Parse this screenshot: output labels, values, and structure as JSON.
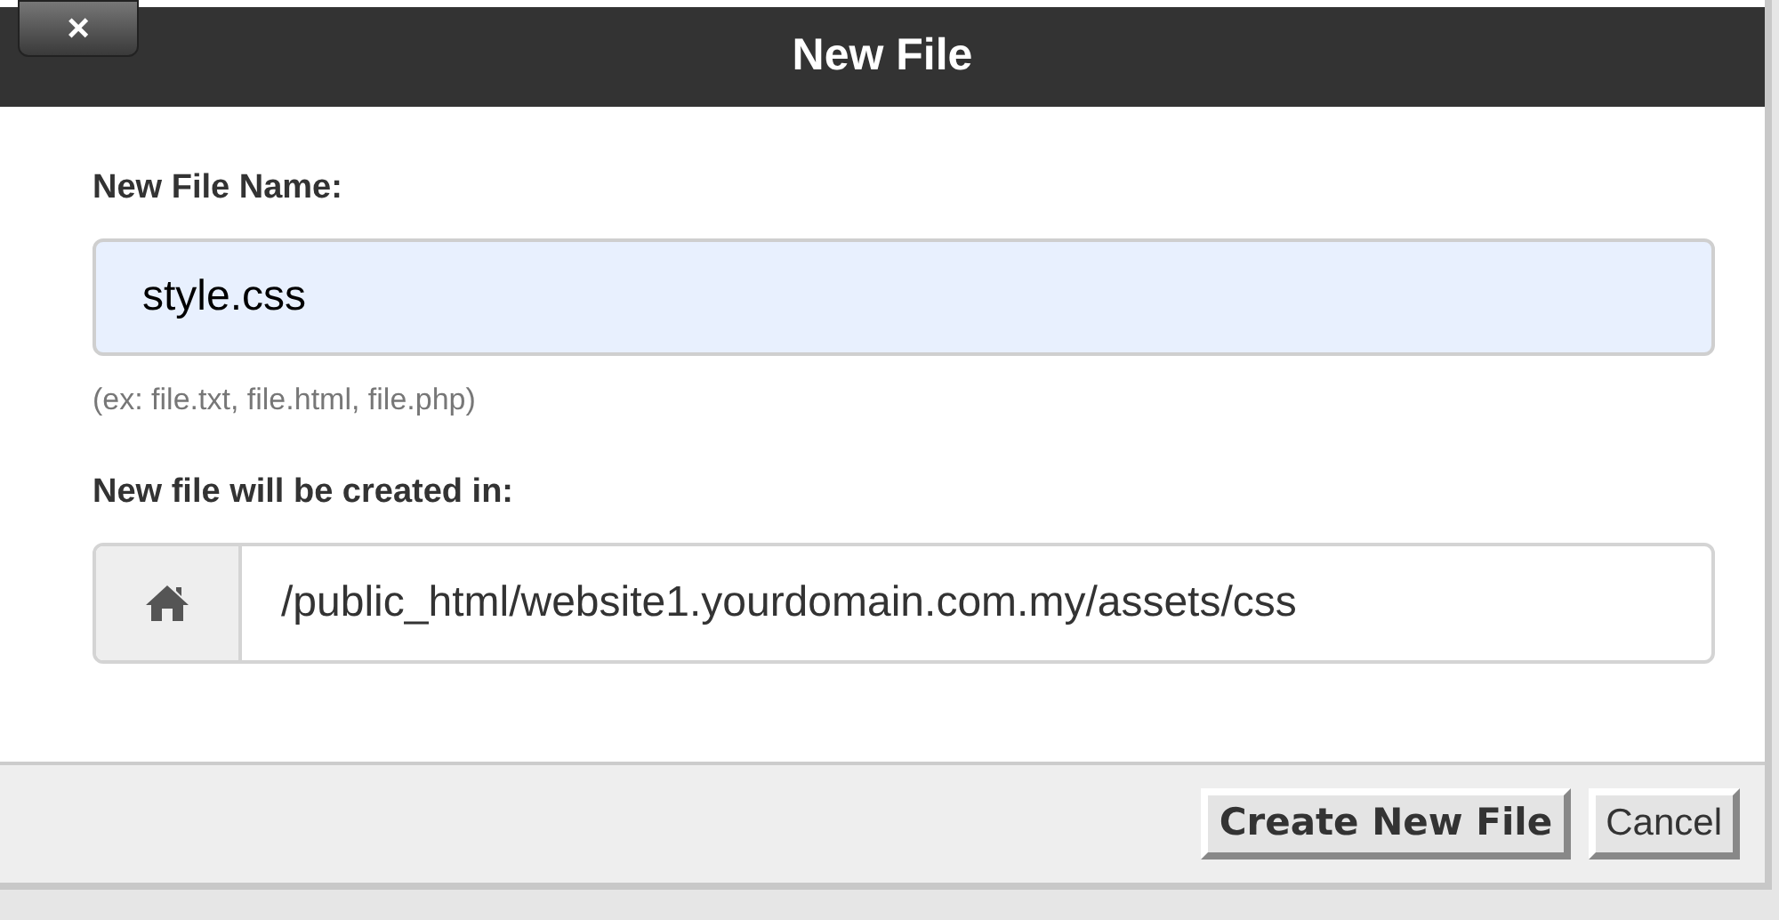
{
  "dialog": {
    "title": "New File",
    "close_label": "×"
  },
  "name_field": {
    "label": "New File Name:",
    "value": "style.css",
    "hint": "(ex: file.txt, file.html, file.php)"
  },
  "location_field": {
    "label": "New file will be created in:",
    "value": "/public_html/website1.yourdomain.com.my/assets/css"
  },
  "buttons": [
    {
      "label": "Create New File",
      "kind": "primary"
    },
    {
      "label": "Cancel",
      "kind": "secondary"
    }
  ]
}
